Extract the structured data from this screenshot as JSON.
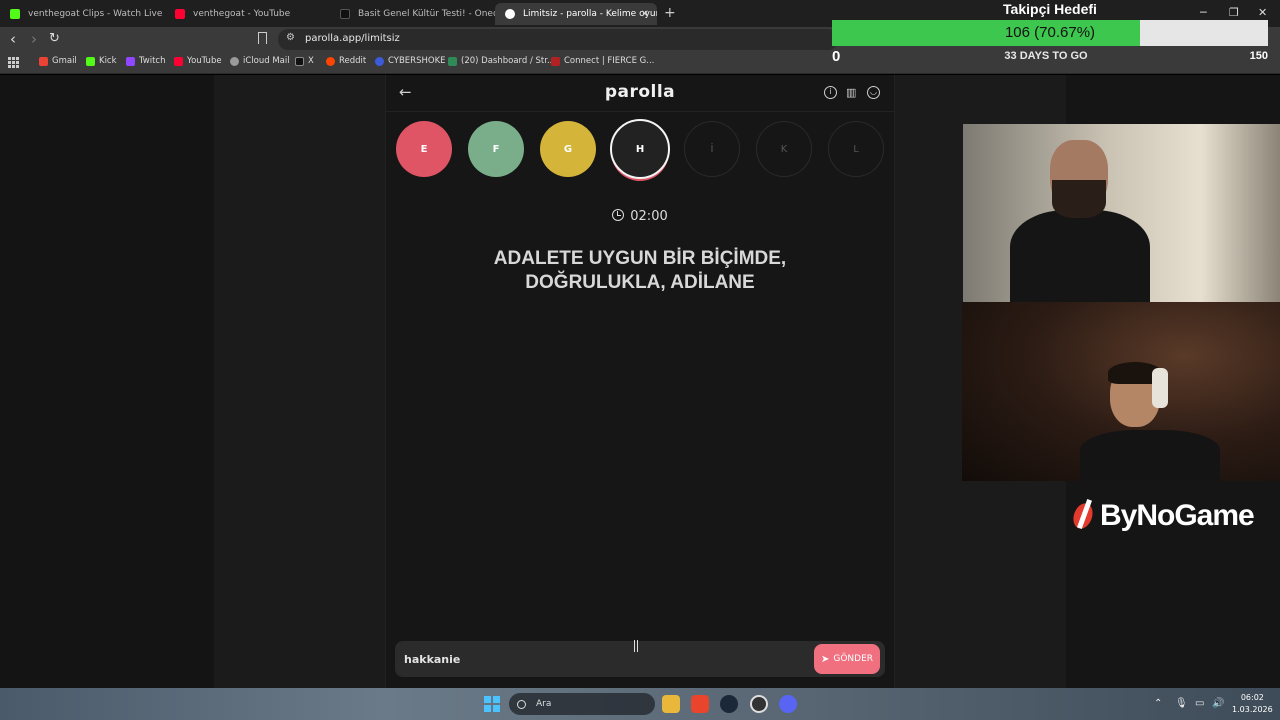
{
  "browser": {
    "tabs": [
      {
        "label": "venthegoat Clips - Watch Live on Kic",
        "favicon_color": "#53fc18"
      },
      {
        "label": "venthegoat - YouTube",
        "favicon_color": "#ff0033"
      },
      {
        "label": "Basit Genel Kültür Testi! - Onedio",
        "favicon_color": "#222222"
      },
      {
        "label": "Limitsiz - parolla - Kelime oyunu",
        "favicon_color": "#ffffff",
        "active": true
      }
    ],
    "url": "parolla.app/limitsiz",
    "bookmarks": [
      {
        "label": "Gmail",
        "color": "#ea4335"
      },
      {
        "label": "Kick",
        "color": "#53fc18"
      },
      {
        "label": "Twitch",
        "color": "#9146ff"
      },
      {
        "label": "YouTube",
        "color": "#ff0033"
      },
      {
        "label": "iCloud Mail",
        "color": "#9a9a9a"
      },
      {
        "label": "X",
        "color": "#111111"
      },
      {
        "label": "Reddit",
        "color": "#ff4500"
      },
      {
        "label": "CYBERSHOKE",
        "color": "#3b5bdb"
      },
      {
        "label": "(20) Dashboard / Str...",
        "color": "#2e8b57"
      },
      {
        "label": "Connect | FIERCE G...",
        "color": "#b22222"
      }
    ]
  },
  "game": {
    "logo": "parolla",
    "letters": [
      {
        "letter": "E",
        "state": "wrong",
        "color": "#e05566"
      },
      {
        "letter": "F",
        "state": "correct",
        "color": "#7aae8a"
      },
      {
        "letter": "G",
        "state": "passed",
        "color": "#d4b53a"
      },
      {
        "letter": "H",
        "state": "active"
      },
      {
        "letter": "İ",
        "state": "pending"
      },
      {
        "letter": "K",
        "state": "pending"
      },
      {
        "letter": "L",
        "state": "pending"
      }
    ],
    "timer": "02:00",
    "clue_line1": "ADALETE UYGUN BİR BİÇİMDE,",
    "clue_line2": "DOĞRULUKLA, ADİLANE",
    "input_value": "hakkanie",
    "send_label": "GÖNDER"
  },
  "overlay": {
    "goal_title": "Takipçi Hedefi",
    "progress_text": "106 (70.67%)",
    "progress_fraction": 0.7067,
    "min_label": "0",
    "days_left": "33 DAYS TO GO",
    "max_label": "150",
    "brand": "ByNoGame"
  },
  "taskbar": {
    "search_label": "Ara",
    "time": "06:02",
    "date": "1.03.2026"
  }
}
